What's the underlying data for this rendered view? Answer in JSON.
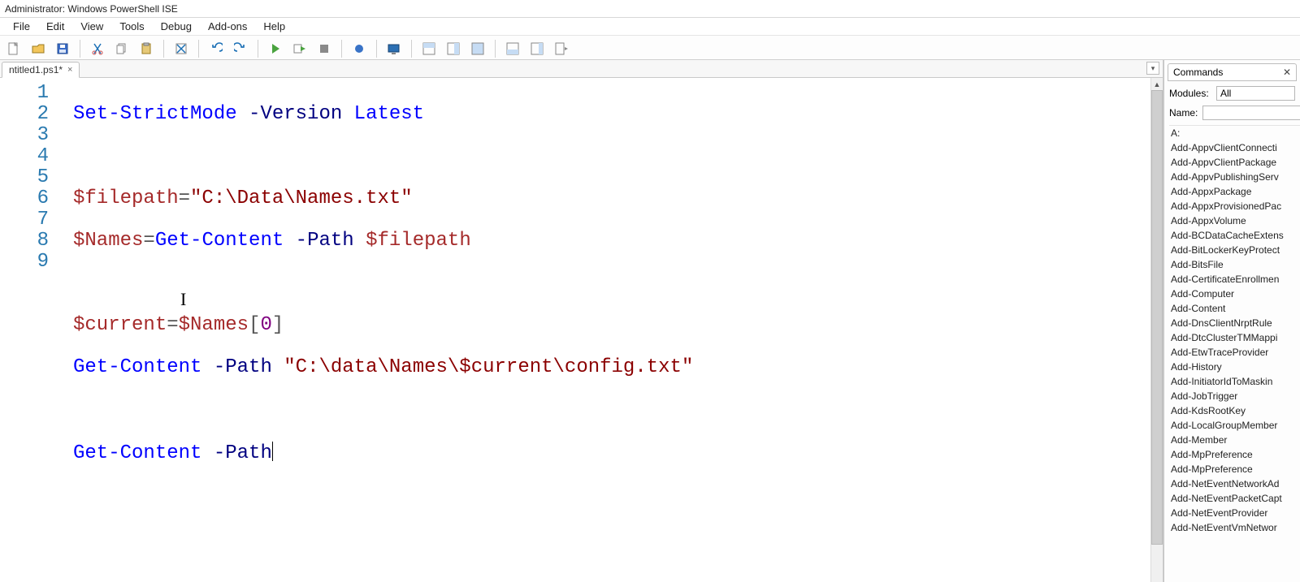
{
  "title": "Administrator: Windows PowerShell ISE",
  "menu": {
    "file": "File",
    "edit": "Edit",
    "view": "View",
    "tools": "Tools",
    "debug": "Debug",
    "addons": "Add-ons",
    "help": "Help"
  },
  "tab": {
    "label": "ntitled1.ps1*",
    "close": "×"
  },
  "script_dropdown": "▾",
  "gutter": [
    "1",
    "2",
    "3",
    "4",
    "5",
    "6",
    "7",
    "8",
    "9"
  ],
  "code": {
    "l1": {
      "cmd": "Set-StrictMode",
      "param": "-Version",
      "arg": "Latest"
    },
    "l3": {
      "var": "$filepath",
      "op": "=",
      "str": "\"C:\\Data\\Names.txt\""
    },
    "l4": {
      "var": "$Names",
      "op": "=",
      "cmd": "Get-Content",
      "param": "-Path",
      "arg": "$filepath"
    },
    "l6": {
      "var": "$current",
      "op": "=",
      "rhs_var": "$Names",
      "idx_open": "[",
      "idx": "0",
      "idx_close": "]"
    },
    "l7": {
      "cmd": "Get-Content",
      "param": "-Path",
      "str": "\"C:\\data\\Names\\$current\\config.txt\""
    },
    "l9": {
      "cmd": "Get-Content",
      "param": "-Path"
    }
  },
  "commands": {
    "header": "Commands",
    "close": "✕",
    "modules_label": "Modules:",
    "modules_value": "All",
    "name_label": "Name:",
    "name_value": "",
    "list": [
      "A:",
      "Add-AppvClientConnecti",
      "Add-AppvClientPackage",
      "Add-AppvPublishingServ",
      "Add-AppxPackage",
      "Add-AppxProvisionedPac",
      "Add-AppxVolume",
      "Add-BCDataCacheExtens",
      "Add-BitLockerKeyProtect",
      "Add-BitsFile",
      "Add-CertificateEnrollmen",
      "Add-Computer",
      "Add-Content",
      "Add-DnsClientNrptRule",
      "Add-DtcClusterTMMappi",
      "Add-EtwTraceProvider",
      "Add-History",
      "Add-InitiatorIdToMaskin",
      "Add-JobTrigger",
      "Add-KdsRootKey",
      "Add-LocalGroupMember",
      "Add-Member",
      "Add-MpPreference",
      "Add-MpPreference",
      "Add-NetEventNetworkAd",
      "Add-NetEventPacketCapt",
      "Add-NetEventProvider",
      "Add-NetEventVmNetwor"
    ]
  },
  "icons": {
    "new": "📄",
    "open": "📂",
    "save": "💾",
    "cut": "✂",
    "copy": "📋",
    "paste": "📋",
    "clear": "▦",
    "undo": "↶",
    "redo": "↷",
    "run": "▶",
    "runsel": "▶",
    "stop": "■",
    "break": "●",
    "remote": "🖥",
    "update": "⟳",
    "pane1": "▥",
    "pane2": "▤",
    "pane3": "▭",
    "cmdpane": "▦",
    "toolpane": "◧",
    "showcmd": "▤▸"
  }
}
